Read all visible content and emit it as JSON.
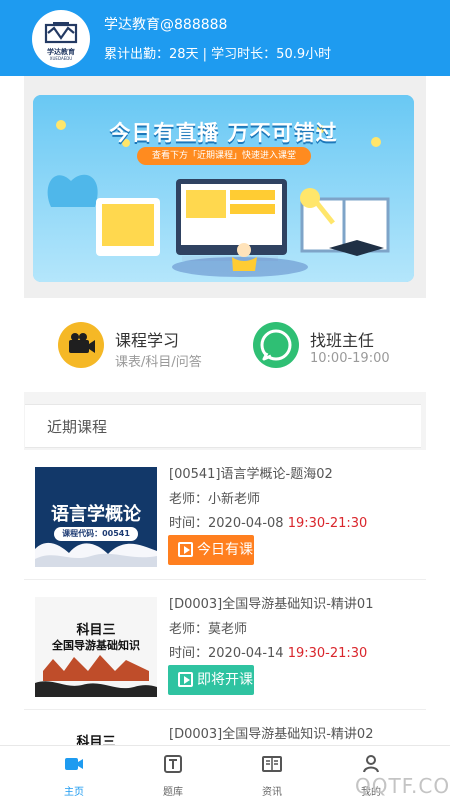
{
  "user": {
    "name": "学达教育@888888",
    "stats": "累计出勤：28天  |  学习时长：50.9小时"
  },
  "logo": {
    "text": "学达教育",
    "subtext": "XUEDAEDU"
  },
  "banner": {
    "title": "今日有直播 万不可错过",
    "subtitle": "查看下方「近期课程」快速进入课堂"
  },
  "quick_actions": [
    {
      "title": "课程学习",
      "subtitle": "课表/科目/问答",
      "icon": "video-camera-icon"
    },
    {
      "title": "找班主任",
      "subtitle": "10:00-19:00",
      "icon": "chat-icon"
    }
  ],
  "section": {
    "title": "近期课程"
  },
  "courses": [
    {
      "title": "[00541]语言学概论-题海02",
      "teacher": "老师：小新老师",
      "date": "时间：2020-04-08",
      "time_range": "19:30-21:30",
      "button": "今日有课",
      "thumb_title": "语言学概论",
      "thumb_code": "课程代码：00541"
    },
    {
      "title": "[D0003]全国导游基础知识-精讲01",
      "teacher": "老师：莫老师",
      "date": "时间：2020-04-14",
      "time_range": "19:30-21:30",
      "button": "即将开课",
      "thumb_line1": "科目三",
      "thumb_line2": "全国导游基础知识"
    },
    {
      "title": "[D0003]全国导游基础知识-精讲02",
      "thumb_line1": "科目三"
    }
  ],
  "bottom_nav": [
    {
      "label": "主页",
      "icon": "video-icon",
      "active": true
    },
    {
      "label": "题库",
      "icon": "question-bank-icon",
      "active": false
    },
    {
      "label": "资讯",
      "icon": "news-icon",
      "active": false
    },
    {
      "label": "我的",
      "icon": "profile-icon",
      "active": false
    }
  ],
  "watermark": "QQTF.COM",
  "colors": {
    "header_blue": "#1e9bf0",
    "orange": "#ff7f1f",
    "green": "#2fc3a1",
    "red_time": "#d9252b"
  }
}
